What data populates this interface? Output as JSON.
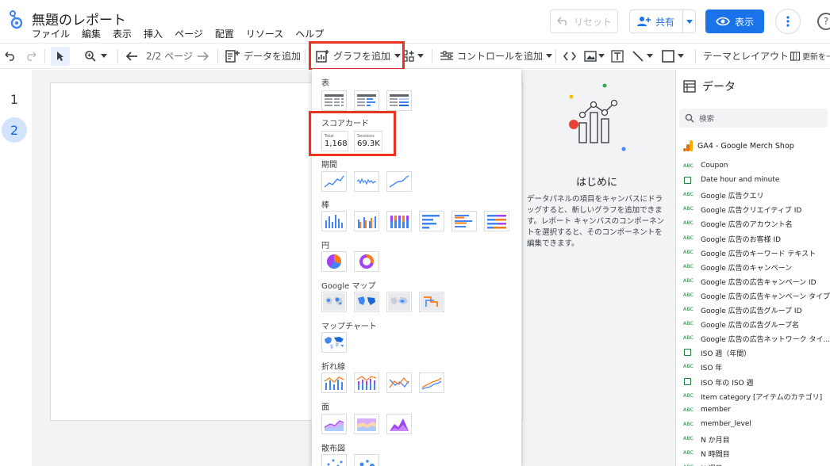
{
  "app": {
    "title": "無題のレポート",
    "menu": [
      "ファイル",
      "編集",
      "表示",
      "挿入",
      "ページ",
      "配置",
      "リソース",
      "ヘルプ"
    ],
    "reset_label": "リセット",
    "share_label": "共有",
    "view_label": "表示",
    "accent": "#1a73e8"
  },
  "toolbar": {
    "page_indicator": "2/2 ページ",
    "add_data": "データを追加",
    "add_chart": "グラフを追加",
    "add_control": "コントロールを追加",
    "theme_layout": "テーマとレイアウト",
    "refresh": "更新を一"
  },
  "pages": [
    "1",
    "2"
  ],
  "chart_menu": {
    "sections": {
      "table": "表",
      "scorecard": "スコアカード",
      "time": "期間",
      "bar": "棒",
      "pie": "円",
      "gmaps": "Google マップ",
      "mapchart": "マップチャート",
      "line": "折れ線",
      "area": "面",
      "scatter": "散布図"
    },
    "scorecards": [
      {
        "label": "Total",
        "value": "1,168"
      },
      {
        "label": "Sessions",
        "value": "69.3K"
      }
    ],
    "highlight_color": "#ea3323"
  },
  "intro": {
    "title": "はじめに",
    "text": "データパネルの項目をキャンバスにドラッグすると、新しいグラフを追加できます。レポート キャンバスのコンポーネントを選択すると、そのコンポーネントを編集できます。"
  },
  "data_panel": {
    "title": "データ",
    "search_placeholder": "検索",
    "source": "GA4 - Google Merch Shop",
    "fields": [
      {
        "type": "ABC",
        "name": "Coupon"
      },
      {
        "type": "date",
        "name": "Date hour and minute"
      },
      {
        "type": "ABC",
        "name": "Google 広告クエリ"
      },
      {
        "type": "ABC",
        "name": "Google 広告クリエイティブ ID"
      },
      {
        "type": "ABC",
        "name": "Google 広告のアカウント名"
      },
      {
        "type": "ABC",
        "name": "Google 広告のお客様 ID"
      },
      {
        "type": "ABC",
        "name": "Google 広告のキーワード テキスト"
      },
      {
        "type": "ABC",
        "name": "Google 広告のキャンペーン"
      },
      {
        "type": "ABC",
        "name": "Google 広告の広告キャンペーン ID"
      },
      {
        "type": "ABC",
        "name": "Google 広告の広告キャンペーン タイプ"
      },
      {
        "type": "ABC",
        "name": "Google 広告の広告グループ ID"
      },
      {
        "type": "ABC",
        "name": "Google 広告の広告グループ名"
      },
      {
        "type": "ABC",
        "name": "Google 広告の広告ネットワーク タイ..."
      },
      {
        "type": "date",
        "name": "ISO 週（年間）"
      },
      {
        "type": "ABC",
        "name": "ISO 年"
      },
      {
        "type": "date",
        "name": "ISO 年の ISO 週"
      },
      {
        "type": "ABC",
        "name": "Item category [アイテムのカテゴリ]"
      },
      {
        "type": "ABC",
        "name": "member"
      },
      {
        "type": "ABC",
        "name": "member_level"
      },
      {
        "type": "ABC",
        "name": "N か月目"
      },
      {
        "type": "ABC",
        "name": "N 時間目"
      },
      {
        "type": "ABC",
        "name": "N 週目"
      }
    ]
  }
}
